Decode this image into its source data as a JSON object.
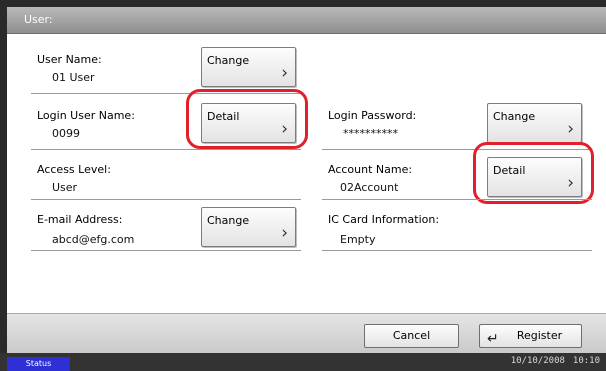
{
  "window": {
    "title": "User:"
  },
  "fields": {
    "user_name": {
      "label": "User Name:",
      "value": "01 User",
      "button": "Change"
    },
    "login_user_name": {
      "label": "Login User Name:",
      "value": "0099",
      "button": "Detail"
    },
    "login_password": {
      "label": "Login Password:",
      "value": "**********",
      "button": "Change"
    },
    "access_level": {
      "label": "Access Level:",
      "value": "User"
    },
    "account_name": {
      "label": "Account Name:",
      "value": "02Account",
      "button": "Detail"
    },
    "email": {
      "label": "E-mail Address:",
      "value": "abcd@efg.com",
      "button": "Change"
    },
    "ic_card": {
      "label": "IC Card Information:",
      "value": "Empty"
    }
  },
  "footer": {
    "cancel": "Cancel",
    "register": "Register"
  },
  "statusbar": {
    "status": "Status",
    "date": "10/10/2008",
    "time": "10:10"
  },
  "icons": {
    "chevron": "chevron-right-icon",
    "register": "return-arrow-icon"
  },
  "colors": {
    "highlight": "#e0202a",
    "status_tab": "#2f2fd6"
  }
}
